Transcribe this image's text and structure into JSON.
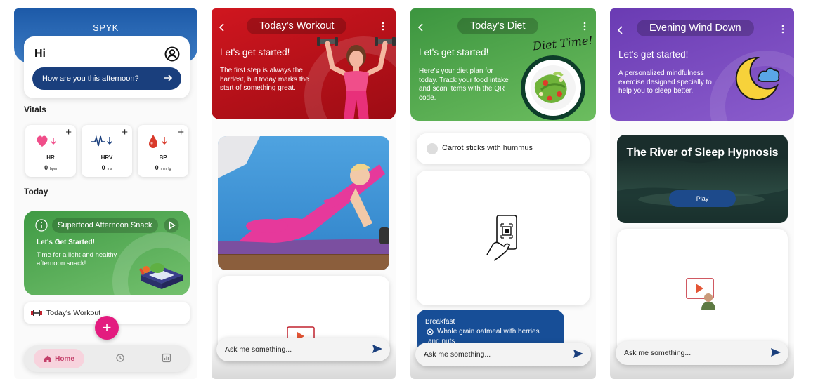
{
  "home": {
    "app_name": "SPYK",
    "greeting": "Hi",
    "prompt": "How are you this afternoon?",
    "vitals_title": "Vitals",
    "vitals": [
      {
        "label": "HR",
        "value": "0",
        "unit": "bpm",
        "icon": "heart-icon",
        "color": "#e8437a"
      },
      {
        "label": "HRV",
        "value": "0",
        "unit": "ms",
        "icon": "heart-rate-wave-icon",
        "color": "#1a3f7d"
      },
      {
        "label": "BP",
        "value": "0",
        "unit": "mmHg",
        "icon": "blood-drop-icon",
        "color": "#d93a2b"
      }
    ],
    "today_title": "Today",
    "snack": {
      "title": "Superfood Afternoon Snack",
      "heading": "Let's Get Started!",
      "body": "Time for a light and healthy afternoon snack!"
    },
    "workout_item": "Today's Workout",
    "nav": {
      "home": "Home"
    }
  },
  "workout": {
    "title": "Today's Workout",
    "lets": "Let's get started!",
    "desc": "The first step is always the hardest, but today marks the start of something great.",
    "ask": "Ask me something..."
  },
  "diet": {
    "title": "Today's Diet",
    "lets": "Let's get started!",
    "desc": "Here's your diet plan for today. Track your food intake and scan items with the QR code.",
    "badge": "Diet Time!",
    "carrot": "Carrot sticks with hummus",
    "breakfast_title": "Breakfast",
    "breakfast_item": "Whole grain oatmeal with berries",
    "breakfast_item_cont": "and nuts",
    "ask": "Ask me something..."
  },
  "evening": {
    "title": "Evening Wind Down",
    "lets": "Let's get started!",
    "desc": "A personalized mindfulness exercise designed specially to help you to sleep better.",
    "river_title": "The River of Sleep Hypnosis",
    "play": "Play",
    "ask": "Ask me something..."
  },
  "colors": {
    "brand_blue": "#1a3f7d",
    "workout_red": "#c8141d",
    "diet_green": "#4da64a",
    "evening_purple": "#7546bf",
    "fab_pink": "#e31b7f"
  }
}
